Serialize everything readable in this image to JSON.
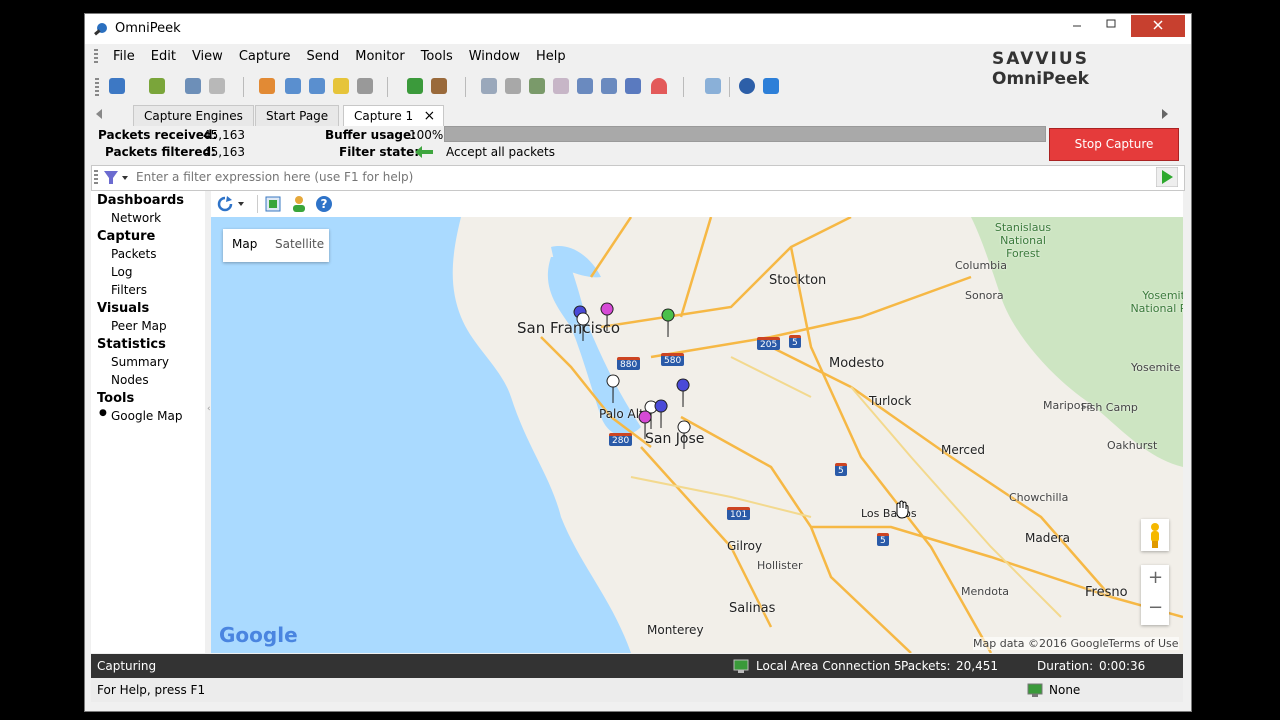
{
  "window": {
    "title": "OmniPeek"
  },
  "menu": [
    "File",
    "Edit",
    "View",
    "Capture",
    "Send",
    "Monitor",
    "Tools",
    "Window",
    "Help"
  ],
  "brand": {
    "left": "SAVVIUS",
    "right": "OmniPeek"
  },
  "tabs": [
    {
      "label": "Capture Engines"
    },
    {
      "label": "Start Page"
    },
    {
      "label": "Capture 1",
      "close": "×"
    }
  ],
  "stats": {
    "packets_received_label": "Packets received:",
    "packets_received_value": "45,163",
    "packets_filtered_label": "Packets filtered:",
    "packets_filtered_value": "45,163",
    "buffer_usage_label": "Buffer usage:",
    "buffer_usage_value": "100%",
    "buffer_usage_fraction": 1.0,
    "filter_state_label": "Filter state:",
    "filter_state_value": "Accept all packets"
  },
  "stop_capture": "Stop Capture",
  "filter": {
    "placeholder": "Enter a filter expression here (use F1 for help)"
  },
  "sidebar": {
    "dashboards": "Dashboards",
    "network": "Network",
    "capture": "Capture",
    "packets": "Packets",
    "log": "Log",
    "filters": "Filters",
    "visuals": "Visuals",
    "peer_map": "Peer Map",
    "statistics": "Statistics",
    "summary": "Summary",
    "nodes": "Nodes",
    "tools": "Tools",
    "google_map": "Google Map"
  },
  "map": {
    "type_map": "Map",
    "type_satellite": "Satellite",
    "google": "Google",
    "attribution": "Map data ©2016 Google",
    "terms": "Terms of Use",
    "zoom_in": "+",
    "zoom_out": "−",
    "places": [
      {
        "name": "San Francisco"
      },
      {
        "name": "Stockton"
      },
      {
        "name": "Modesto"
      },
      {
        "name": "Turlock"
      },
      {
        "name": "Merced"
      },
      {
        "name": "Palo Alto"
      },
      {
        "name": "San Jose"
      },
      {
        "name": "Gilroy"
      },
      {
        "name": "Hollister"
      },
      {
        "name": "Salinas"
      },
      {
        "name": "Monterey"
      },
      {
        "name": "Los Banos"
      },
      {
        "name": "Chowchilla"
      },
      {
        "name": "Madera"
      },
      {
        "name": "Fresno"
      },
      {
        "name": "Mendota"
      },
      {
        "name": "Oakhurst"
      },
      {
        "name": "Mariposa"
      },
      {
        "name": "Yosemite National Park"
      },
      {
        "name": "Stanislaus National Forest"
      },
      {
        "name": "Columbia"
      },
      {
        "name": "Sonora"
      },
      {
        "name": "Yosemite Valley"
      },
      {
        "name": "Fish Camp"
      }
    ],
    "highways": [
      "880",
      "580",
      "205",
      "5",
      "5",
      "5",
      "280",
      "101"
    ]
  },
  "status": {
    "state": "Capturing",
    "adapter": "Local Area Connection 5",
    "packets_label": "Packets:",
    "packets_value": "20,451",
    "duration_label": "Duration:",
    "duration_value": "0:00:36"
  },
  "help": {
    "text": "For Help, press F1",
    "none": "None"
  },
  "colors": {
    "stop": "#e53b3b",
    "water": "#aadaff",
    "land": "#f2efe9",
    "road": "#f6b845"
  }
}
